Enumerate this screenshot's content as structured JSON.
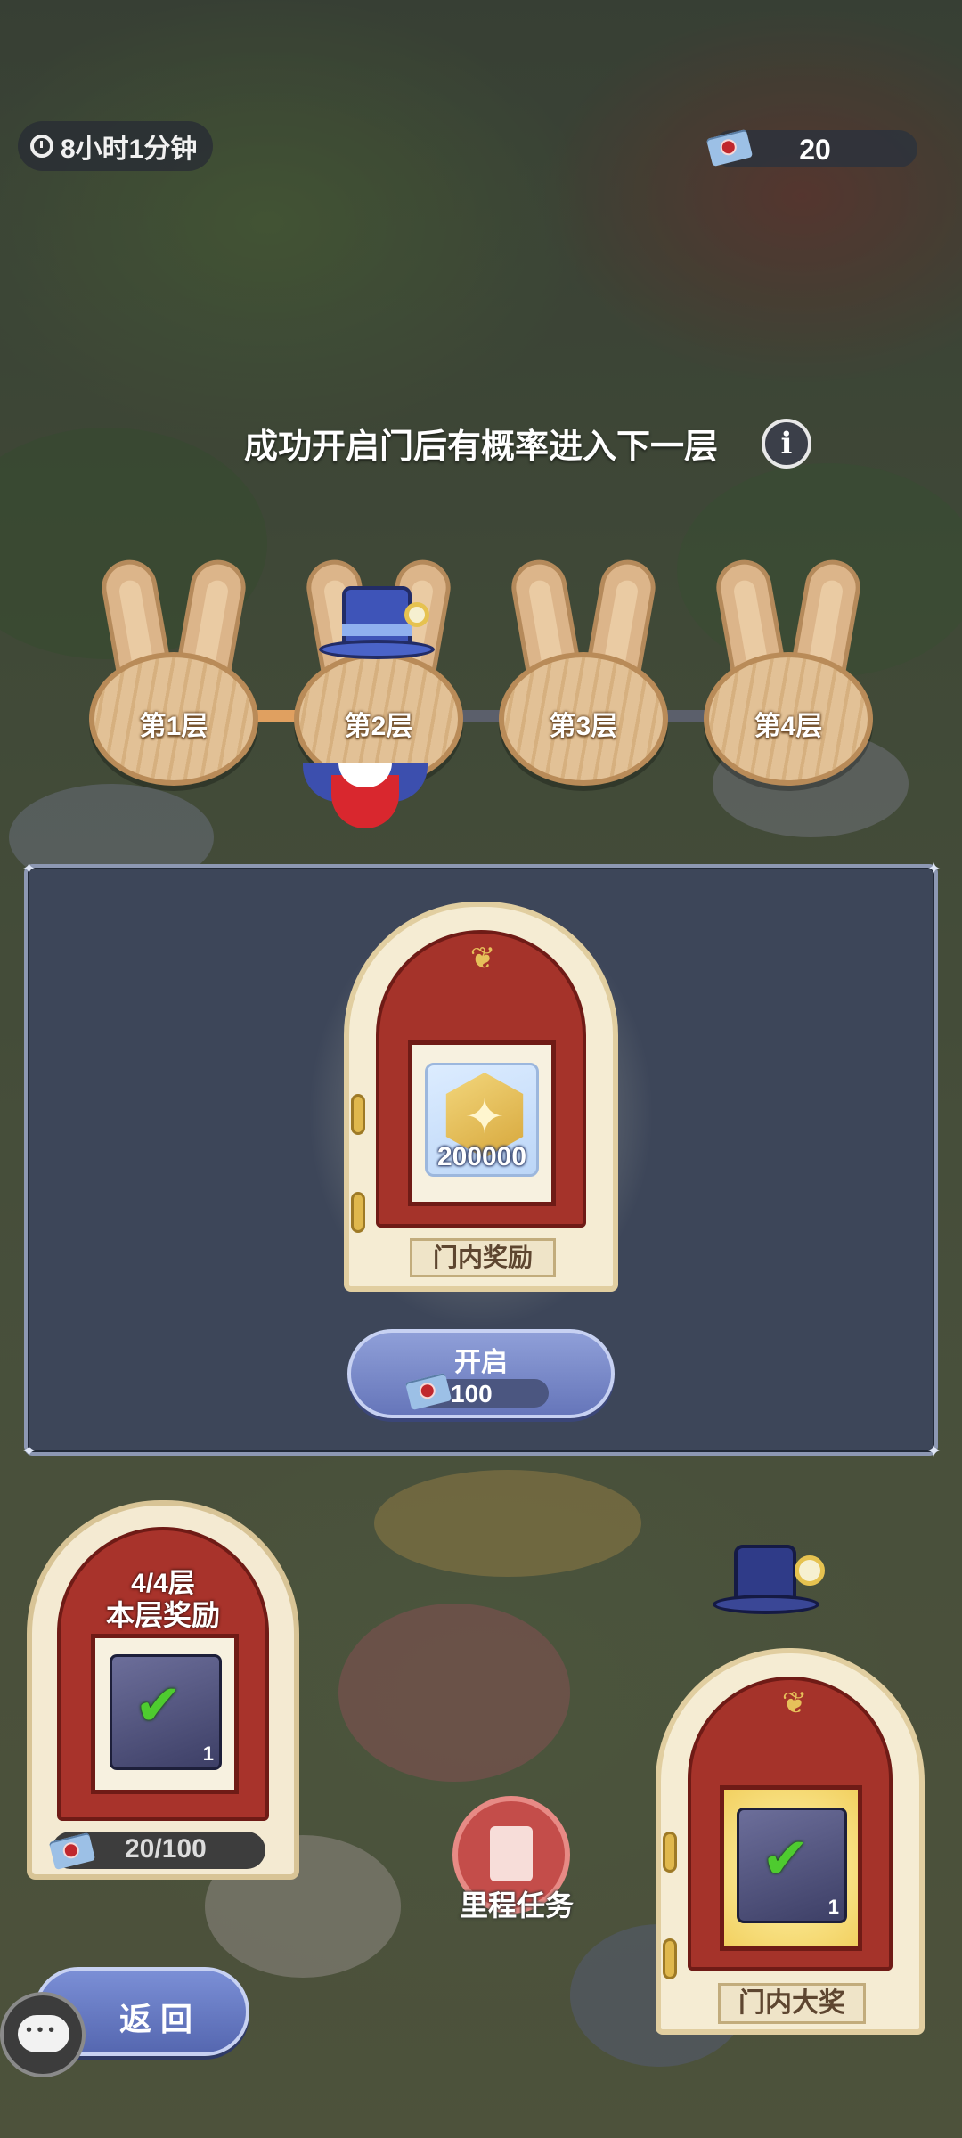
{
  "header": {
    "timer_text": "8小时1分钟",
    "mail_count": "20"
  },
  "hint": {
    "text": "成功开启门后有概率进入下一层"
  },
  "floors": [
    {
      "label": "第1层"
    },
    {
      "label": "第2层",
      "current": true
    },
    {
      "label": "第3层"
    },
    {
      "label": "第4层"
    }
  ],
  "modal": {
    "reward_amount": "200000",
    "door_label": "门内奖励",
    "open_button": {
      "label": "开启",
      "cost": "100"
    }
  },
  "floor_reward": {
    "floor_progress": "4/4层",
    "title": "本层奖励",
    "item_count": "1",
    "progress": "20/100"
  },
  "grand_prize": {
    "label": "门内大奖",
    "item_count": "1"
  },
  "milestone": {
    "label": "里程任务"
  },
  "back_button": {
    "label": "返回"
  },
  "icons": {
    "timer": "clock-icon",
    "currency": "envelope-icon",
    "info": "info-icon",
    "chat": "chat-icon",
    "check": "checkmark-icon"
  },
  "colors": {
    "modal_bg": "#3d4659",
    "door_red": "#a5332a",
    "button_blue": "#6676ba",
    "check_green": "#4ecb2f"
  }
}
